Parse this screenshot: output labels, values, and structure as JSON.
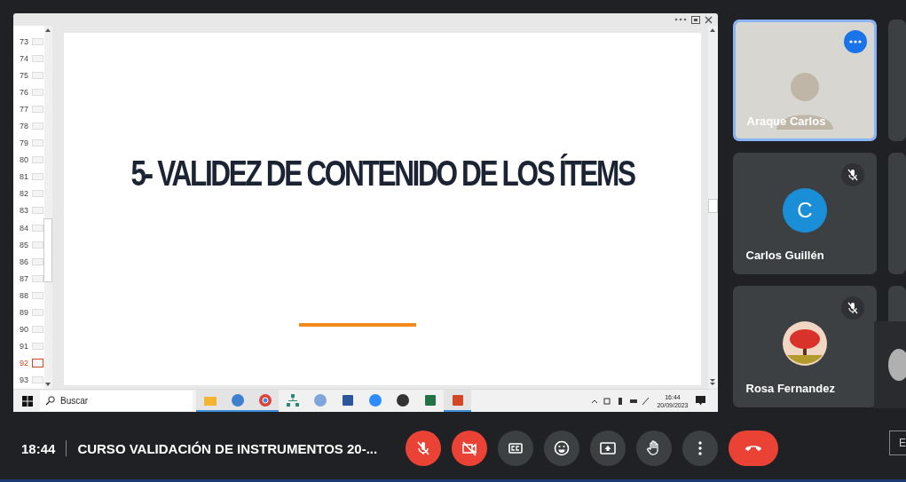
{
  "shared_screen": {
    "slides": [
      {
        "number": "73",
        "selected": false
      },
      {
        "number": "74",
        "selected": false
      },
      {
        "number": "75",
        "selected": false
      },
      {
        "number": "76",
        "selected": false
      },
      {
        "number": "77",
        "selected": false
      },
      {
        "number": "78",
        "selected": false
      },
      {
        "number": "79",
        "selected": false
      },
      {
        "number": "80",
        "selected": false
      },
      {
        "number": "81",
        "selected": false
      },
      {
        "number": "82",
        "selected": false
      },
      {
        "number": "83",
        "selected": false
      },
      {
        "number": "84",
        "selected": false
      },
      {
        "number": "85",
        "selected": false
      },
      {
        "number": "86",
        "selected": false
      },
      {
        "number": "87",
        "selected": false
      },
      {
        "number": "88",
        "selected": false
      },
      {
        "number": "89",
        "selected": false
      },
      {
        "number": "90",
        "selected": false
      },
      {
        "number": "91",
        "selected": false
      },
      {
        "number": "92",
        "selected": true
      },
      {
        "number": "93",
        "selected": false
      }
    ],
    "slide": {
      "title": "5- VALIDEZ DE CONTENIDO DE LOS ÍTEMS"
    },
    "taskbar": {
      "search": {
        "placeholder": "Buscar"
      },
      "apps": [
        {
          "kind": "folder",
          "active": true
        },
        {
          "kind": "globe",
          "active": true
        },
        {
          "kind": "chrome",
          "active": true
        },
        {
          "kind": "network",
          "active": false
        },
        {
          "kind": "r",
          "active": false
        },
        {
          "kind": "word",
          "active": false
        },
        {
          "kind": "zoom",
          "active": false
        },
        {
          "kind": "camera",
          "active": false
        },
        {
          "kind": "excel",
          "active": false
        },
        {
          "kind": "powerpoint",
          "active": true
        }
      ],
      "clock": {
        "time": "16:44",
        "date": "20/09/2023"
      }
    }
  },
  "participants": [
    {
      "name": "Araque Carlos",
      "kind": "video",
      "speaking": true,
      "muted": false
    },
    {
      "name": "Carlos Guillén",
      "kind": "initial",
      "initial": "C",
      "speaking": false,
      "muted": true
    },
    {
      "name": "Rosa Fernandez",
      "kind": "avatar",
      "speaking": false,
      "muted": true
    }
  ],
  "meeting_bar": {
    "time": "18:44",
    "title": "CURSO VALIDACIÓN DE INSTRUMENTOS 20-...",
    "controls": [
      {
        "kind": "mic",
        "on": false
      },
      {
        "kind": "camera",
        "on": false
      },
      {
        "kind": "captions",
        "on": false
      },
      {
        "kind": "emoji",
        "on": false
      },
      {
        "kind": "present",
        "on": false
      },
      {
        "kind": "hand",
        "on": false
      },
      {
        "kind": "more",
        "on": false
      },
      {
        "kind": "end",
        "on": false
      }
    ],
    "partial_button": "E"
  }
}
